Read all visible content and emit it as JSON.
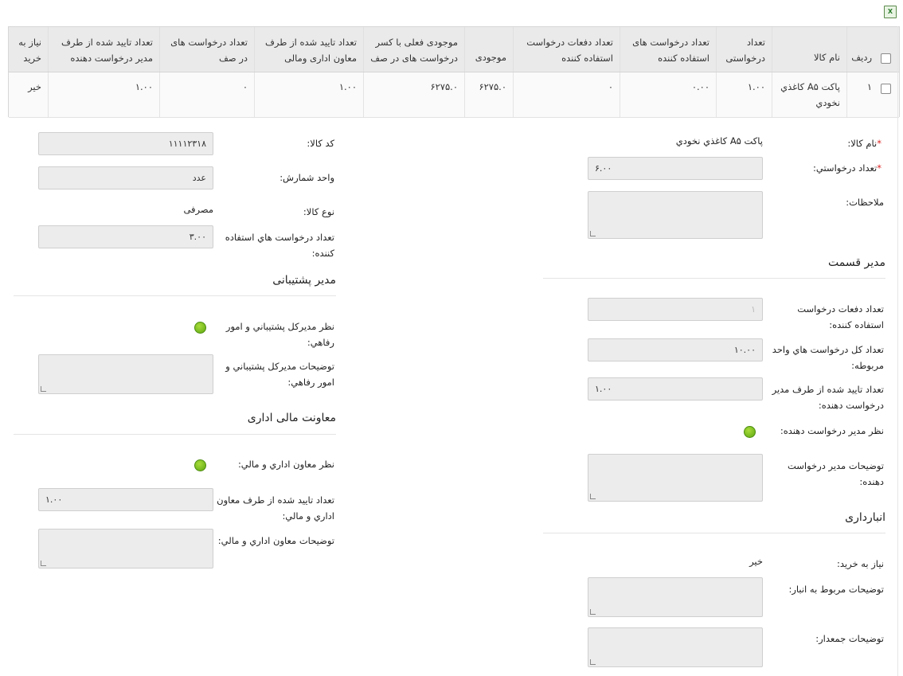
{
  "excel_icon": "excel-icon",
  "excel_text": "X",
  "grid": {
    "headers": {
      "row_num": "ردیف",
      "item_name": "نام کالا",
      "request_qty": "تعداد درخواستی",
      "requester_requests": "تعداد درخواست های استفاده کننده",
      "request_times": "تعداد دفعات درخواست استفاده کننده",
      "stock": "موجودی",
      "current_stock": "موجودی فعلی با کسر درخواست های در صف",
      "approved_deputy": "تعداد تایید شده از طرف معاون اداری ومالی",
      "queued_requests": "تعداد درخواست های در صف",
      "approved_manager": "تعداد تایید شده از طرف مدیر درخواست دهنده",
      "need_purchase": "نیاز به خرید"
    },
    "row": {
      "row_num": "۱",
      "item_name": "پاکت A۵ کاغذي نخودي",
      "request_qty": "۱.۰۰",
      "requester_requests": "۰.۰۰",
      "request_times": "۰",
      "stock": "۶۲۷۵.۰",
      "current_stock": "۶۲۷۵.۰",
      "approved_deputy": "۱.۰۰",
      "queued_requests": "۰",
      "approved_manager": "۱.۰۰",
      "need_purchase": "خیر"
    }
  },
  "form": {
    "item_name_label": "نام کالا:",
    "item_name_value": "پاکت A۵ کاغذي نخودي",
    "request_qty_label": "تعداد درخواستي:",
    "request_qty_value": "۶.۰۰",
    "notes_label": "ملاحظات:",
    "code_label": "کد کالا:",
    "code_value": "۱۱۱۱۲۳۱۸",
    "unit_label": "واحد شمارش:",
    "unit_value": "عدد",
    "type_label": "نوع کالا:",
    "type_value": "مصرفی",
    "user_requests_label": "تعداد درخواست هاي استفاده کننده:",
    "user_requests_value": "۳.۰۰"
  },
  "manager_section": {
    "title": "مدیر قسمت",
    "times_label": "تعداد دفعات درخواست استفاده کننده:",
    "times_value": "۱",
    "total_label": "تعداد کل درخواست هاي واحد مربوطه:",
    "total_value": "۱۰.۰۰",
    "approved_label": "تعداد تایید شده از طرف مدیر درخواست دهنده:",
    "approved_value": "۱.۰۰",
    "opinion_label": "نظر مدیر درخواست دهنده:",
    "desc_label": "توضیحات مدیر درخواست دهنده:"
  },
  "support_section": {
    "title": "مدیر پشتیبانی",
    "opinion_label": "نظر مدیرکل پشتيباني و امور رفاهي:",
    "desc_label": "توضیحات مدیرکل پشتيباني و امور رفاهي:"
  },
  "finance_section": {
    "title": "معاونت مالی اداری",
    "opinion_label": "نظر معاون اداري و مالي:",
    "approved_label": "تعداد تایید شده از طرف معاون اداري و مالي:",
    "approved_value": "۱.۰۰",
    "desc_label": "توضیحات معاون اداري و مالي:"
  },
  "warehouse_section": {
    "title": "انبارداری",
    "need_label": "نیاز به خرید:",
    "need_value": "خیر",
    "warehouse_desc_label": "توضیحات مربوط به انبار:",
    "collector_desc_label": "توضیحات جمعدار:"
  },
  "colors": {
    "status_green": "#6cb317",
    "required_star": "#dd2222"
  }
}
